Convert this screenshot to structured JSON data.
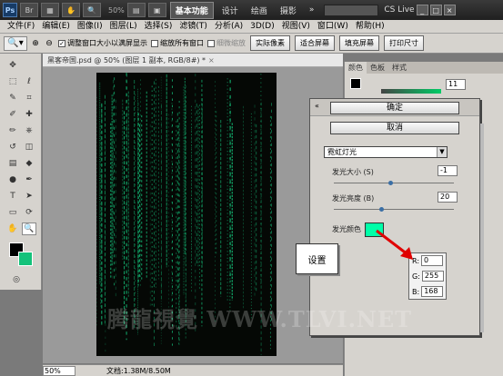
{
  "titlebar": {
    "logo": "Ps",
    "zoom": "50%",
    "workspace_buttons": [
      "基本功能",
      "设计",
      "绘画",
      "摄影"
    ],
    "more": "»",
    "cs_live": "CS Live",
    "window_controls": [
      "_",
      "□",
      "×"
    ]
  },
  "menubar": {
    "items": [
      "文件(F)",
      "编辑(E)",
      "图像(I)",
      "图层(L)",
      "选择(S)",
      "滤镜(T)",
      "分析(A)",
      "3D(D)",
      "视图(V)",
      "窗口(W)",
      "帮助(H)"
    ]
  },
  "options": {
    "tool_icon": "zoom-tool",
    "check1": "调整窗口大小以满屏显示",
    "check2": "缩放所有窗口",
    "check3": "细微缩放",
    "buttons": [
      "实际像素",
      "适合屏幕",
      "填充屏幕",
      "打印尺寸"
    ]
  },
  "document": {
    "tab_title": "黑客帝国.psd @ 50% (图层 1 副本, RGB/8#) *",
    "close": "×",
    "zoom": "50%",
    "docinfo": "文档:1.38M/8.50M"
  },
  "right_panel": {
    "tabs": [
      "颜色",
      "色板",
      "样式"
    ],
    "value": "11"
  },
  "effect_panel": {
    "ok": "确定",
    "cancel": "取消",
    "filter": "霓虹灯光",
    "glow_size_label": "发光大小 (S)",
    "glow_size_value": "-1",
    "glow_brightness_label": "发光亮度 (B)",
    "glow_brightness_value": "20",
    "glow_color_label": "发光颜色",
    "glow_color": "#00ffa8",
    "r_label": "R:",
    "r_value": "0",
    "g_label": "G:",
    "g_value": "255",
    "b_label": "B:",
    "b_value": "168"
  },
  "callout": {
    "text": "设置"
  },
  "watermark": "腾龍視覺 WWW.TLVI.NET",
  "colors": {
    "matrix_green": "#14c27a",
    "arrow_red": "#e00000"
  }
}
